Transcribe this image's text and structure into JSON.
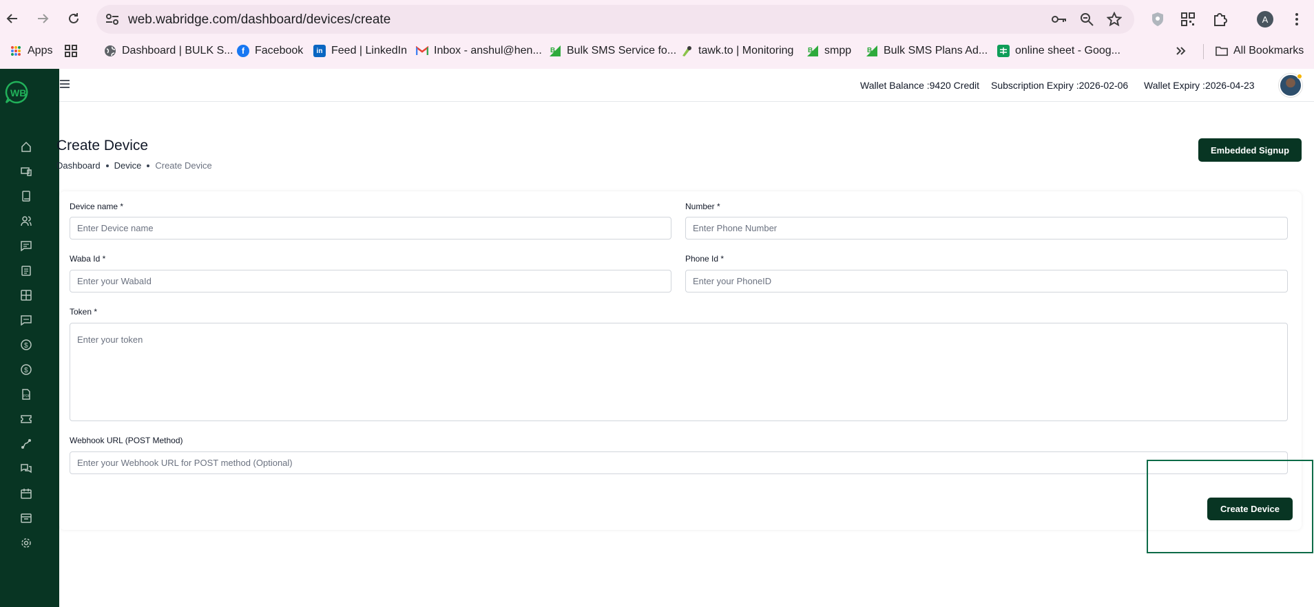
{
  "browser": {
    "url": "web.wabridge.com/dashboard/devices/create",
    "profile_initial": "A",
    "bookmarks": [
      {
        "label": "Apps",
        "icon": "apps-grid-icon"
      },
      {
        "label": "Dashboard | BULK S...",
        "icon": "globe-icon"
      },
      {
        "label": "Facebook",
        "icon": "facebook-icon"
      },
      {
        "label": "Feed | LinkedIn",
        "icon": "linkedin-icon"
      },
      {
        "label": "Inbox - anshul@hen...",
        "icon": "gmail-icon"
      },
      {
        "label": "Bulk SMS Service fo...",
        "icon": "bulksms-icon"
      },
      {
        "label": "tawk.to | Monitoring",
        "icon": "tawk-icon"
      },
      {
        "label": "smpp",
        "icon": "bulksms-icon"
      },
      {
        "label": "Bulk SMS Plans Ad...",
        "icon": "bulksms-icon"
      },
      {
        "label": "online sheet - Goog...",
        "icon": "sheets-icon"
      }
    ],
    "all_bookmarks": "All Bookmarks"
  },
  "header": {
    "wallet_label": "Wallet Balance :",
    "wallet_value": "9420 Credit",
    "subscription_label": "Subscription Expiry :",
    "subscription_value": "2026-02-06",
    "wallet_expiry_label": "Wallet Expiry :",
    "wallet_expiry_value": "2026-04-23"
  },
  "page": {
    "title": "Create Device",
    "breadcrumb": [
      "Dashboard",
      "Device",
      "Create Device"
    ],
    "embedded_signup": "Embedded Signup"
  },
  "form": {
    "device_name": {
      "label": "Device name *",
      "placeholder": "Enter Device name"
    },
    "number": {
      "label": "Number *",
      "placeholder": "Enter Phone Number"
    },
    "waba_id": {
      "label": "Waba Id *",
      "placeholder": "Enter your WabaId"
    },
    "phone_id": {
      "label": "Phone Id *",
      "placeholder": "Enter your PhoneID"
    },
    "token": {
      "label": "Token *",
      "placeholder": "Enter your token"
    },
    "webhook": {
      "label": "Webhook URL (POST Method)",
      "placeholder": "Enter your Webhook URL for POST method (Optional)"
    },
    "submit": "Create Device"
  },
  "theme": {
    "brand": "#083523",
    "highlight": "#0c6a47"
  }
}
